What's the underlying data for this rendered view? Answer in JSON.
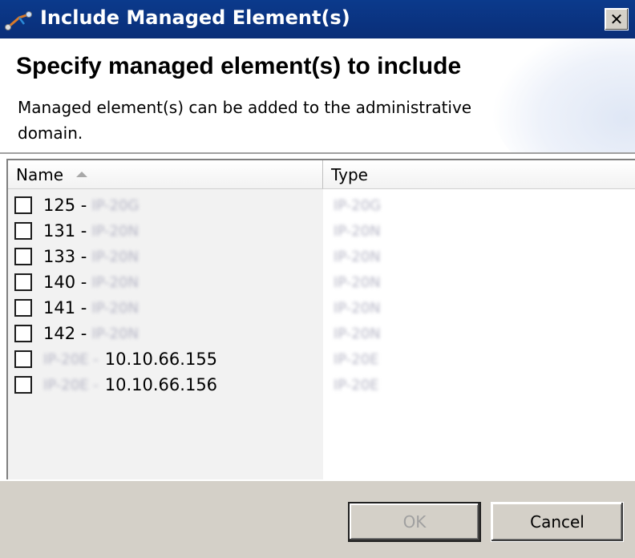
{
  "window": {
    "title": "Include Managed Element(s)",
    "close_glyph": "✕"
  },
  "header": {
    "title": "Specify managed element(s) to include",
    "description": "Managed element(s) can be added to the administrative domain."
  },
  "list": {
    "columns": [
      {
        "label": "Name",
        "sorted": "ascending"
      },
      {
        "label": "Type"
      }
    ],
    "rows": [
      {
        "checked": false,
        "name_prefix": "125 -",
        "name_blurred": "IP-20G",
        "name_suffix": "",
        "type_blurred": "IP-20G"
      },
      {
        "checked": false,
        "name_prefix": "131 -",
        "name_blurred": "IP-20N",
        "name_suffix": "",
        "type_blurred": "IP-20N"
      },
      {
        "checked": false,
        "name_prefix": "133 -",
        "name_blurred": "IP-20N",
        "name_suffix": "",
        "type_blurred": "IP-20N"
      },
      {
        "checked": false,
        "name_prefix": "140 -",
        "name_blurred": "IP-20N",
        "name_suffix": "",
        "type_blurred": "IP-20N"
      },
      {
        "checked": false,
        "name_prefix": "141 -",
        "name_blurred": "IP-20N",
        "name_suffix": "",
        "type_blurred": "IP-20N"
      },
      {
        "checked": false,
        "name_prefix": "142 -",
        "name_blurred": "IP-20N",
        "name_suffix": "",
        "type_blurred": "IP-20N"
      },
      {
        "checked": false,
        "name_prefix": "",
        "name_blurred": "IP-20E -",
        "name_suffix": "10.10.66.155",
        "type_blurred": "IP-20E"
      },
      {
        "checked": false,
        "name_prefix": "",
        "name_blurred": "IP-20E -",
        "name_suffix": "10.10.66.156",
        "type_blurred": "IP-20E"
      }
    ]
  },
  "footer": {
    "ok_label": "OK",
    "ok_enabled": false,
    "cancel_label": "Cancel"
  }
}
